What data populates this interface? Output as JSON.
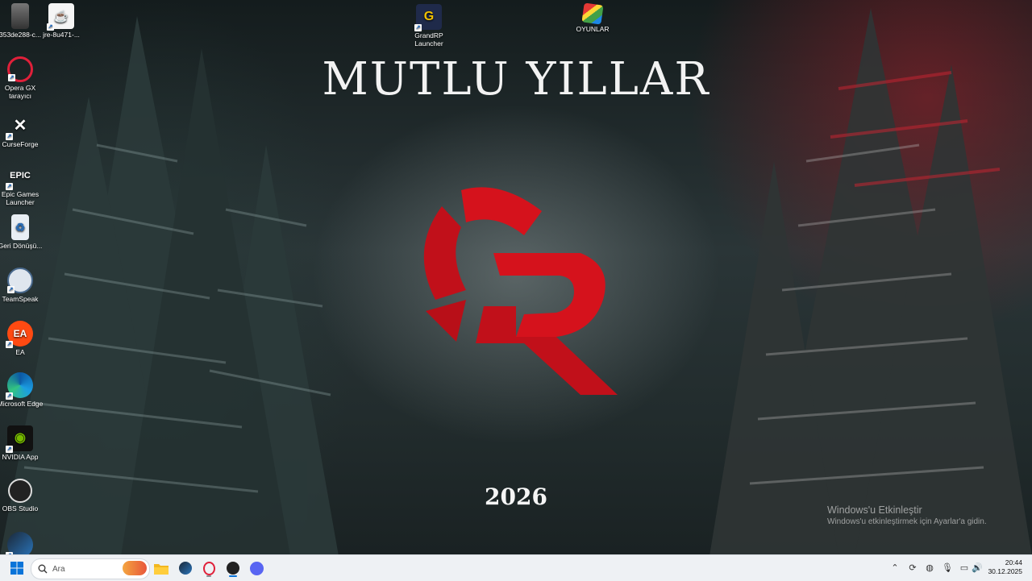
{
  "wallpaper": {
    "headline": "MUTLU YILLAR",
    "year": "2026",
    "accent_color": "#d5121c"
  },
  "desktop_icons": [
    {
      "label": "353de288-c...",
      "icon": "image-file-icon"
    },
    {
      "label": "jre-8u471-...",
      "icon": "java-installer-icon"
    },
    {
      "label": "Opera GX tarayıcı",
      "icon": "opera-gx-icon"
    },
    {
      "label": "CurseForge",
      "icon": "curseforge-icon"
    },
    {
      "label": "Epic Games Launcher",
      "icon": "epic-games-icon"
    },
    {
      "label": "Geri Dönüşü...",
      "icon": "recycle-bin-icon"
    },
    {
      "label": "TeamSpeak",
      "icon": "teamspeak-icon"
    },
    {
      "label": "EA",
      "icon": "ea-icon"
    },
    {
      "label": "Microsoft Edge",
      "icon": "edge-icon"
    },
    {
      "label": "NVIDIA App",
      "icon": "nvidia-icon"
    },
    {
      "label": "OBS Studio",
      "icon": "obs-icon"
    },
    {
      "label": "",
      "icon": "steam-icon"
    },
    {
      "label": "GrandRP Launcher",
      "icon": "grandrp-icon"
    },
    {
      "label": "OYUNLAR",
      "icon": "games-folder-icon"
    }
  ],
  "activation": {
    "title": "Windows'u Etkinleştir",
    "subtitle": "Windows'u etkinleştirmek için Ayarlar'a gidin."
  },
  "taskbar": {
    "search_placeholder": "Ara",
    "pinned": [
      "file-explorer-icon",
      "steam-icon",
      "opera-gx-icon",
      "obs-icon",
      "discord-icon"
    ],
    "tray": [
      "chevron-up-icon",
      "sync-icon",
      "network-icon",
      "microphone-icon",
      "display-icon",
      "volume-icon"
    ],
    "time": "20:44",
    "date": "30.12.2025"
  }
}
